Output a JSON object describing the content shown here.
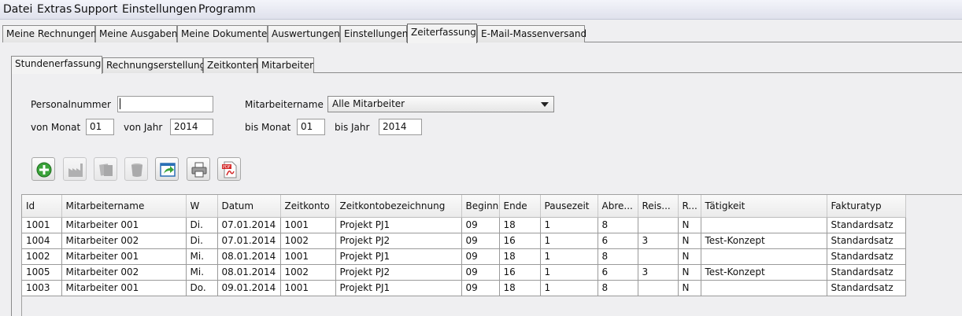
{
  "menu": [
    "Datei",
    "Extras",
    "Support",
    "Einstellungen",
    "Programm"
  ],
  "main_tabs": [
    "Meine Rechnungen",
    "Meine Ausgaben",
    "Meine Dokumente",
    "Auswertungen",
    "Einstellungen",
    "Zeiterfassung",
    "E-Mail-Massenversand"
  ],
  "main_tab_active": "Zeiterfassung",
  "sub_tabs": [
    "Stundenerfassung",
    "Rechnungserstellung",
    "Zeitkonten",
    "Mitarbeiter"
  ],
  "sub_tab_active": "Stundenerfassung",
  "filters": {
    "personalnummer_label": "Personalnummer",
    "personalnummer_value": "",
    "mitarbeitername_label": "Mitarbeitername",
    "mitarbeitername_value": "Alle Mitarbeiter",
    "von_monat_label": "von Monat",
    "von_monat_value": "01",
    "von_jahr_label": "von Jahr",
    "von_jahr_value": "2014",
    "bis_monat_label": "bis Monat",
    "bis_monat_value": "01",
    "bis_jahr_label": "bis Jahr",
    "bis_jahr_value": "2014"
  },
  "toolbar_icons": [
    "add-icon",
    "factory-icon",
    "copy-icon",
    "trash-icon",
    "export-icon",
    "print-icon",
    "pdf-icon"
  ],
  "colors": {
    "add_green": "#3aa33a",
    "pdf_red": "#d42a2a",
    "export_blue": "#2a6fb5"
  },
  "table": {
    "columns": [
      "Id",
      "Mitarbeitername",
      "W",
      "Datum",
      "Zeitkonto",
      "Zeitkontobezeichnung",
      "Beginn",
      "Ende",
      "Pausezeit",
      "Abre...",
      "Reis...",
      "R...",
      "Tätigkeit",
      "Fakturatyp"
    ],
    "rows": [
      [
        "1001",
        "Mitarbeiter 001",
        "Di.",
        "07.01.2014",
        "1001",
        "Projekt PJ1",
        "09",
        "18",
        "1",
        "8",
        "",
        "N",
        "",
        "Standardsatz"
      ],
      [
        "1004",
        "Mitarbeiter 002",
        "Di.",
        "07.01.2014",
        "1002",
        "Projekt PJ2",
        "09",
        "16",
        "1",
        "6",
        "3",
        "N",
        "Test-Konzept",
        "Standardsatz"
      ],
      [
        "1002",
        "Mitarbeiter 001",
        "Mi.",
        "08.01.2014",
        "1001",
        "Projekt PJ1",
        "09",
        "18",
        "1",
        "8",
        "",
        "N",
        "",
        "Standardsatz"
      ],
      [
        "1005",
        "Mitarbeiter 002",
        "Mi.",
        "08.01.2014",
        "1002",
        "Projekt PJ2",
        "09",
        "16",
        "1",
        "6",
        "3",
        "N",
        "Test-Konzept",
        "Standardsatz"
      ],
      [
        "1003",
        "Mitarbeiter 001",
        "Do.",
        "09.01.2014",
        "1001",
        "Projekt PJ1",
        "09",
        "18",
        "1",
        "8",
        "",
        "N",
        "",
        "Standardsatz"
      ]
    ]
  }
}
